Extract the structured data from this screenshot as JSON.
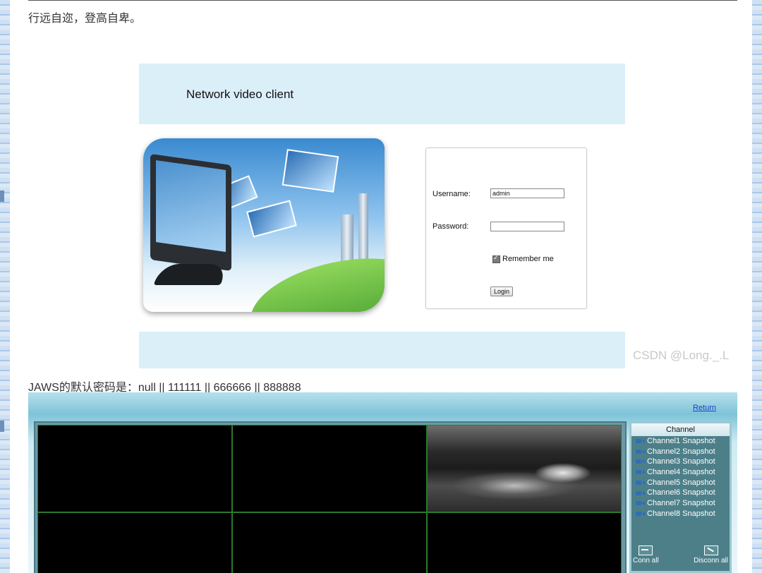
{
  "page": {
    "motto": "行远自迩，登高自卑。",
    "watermark": "CSDN @Long._.L",
    "jaws_note": "JAWS的默认密码是：null || 111111 || 666666 || 888888"
  },
  "login_screen": {
    "banner_title": "Network video client",
    "username_label": "Username:",
    "username_value": "admin",
    "password_label": "Password:",
    "password_value": "",
    "remember_label": "Remember me",
    "remember_checked": true,
    "login_button": "Login"
  },
  "viewer": {
    "return_link": "Return",
    "channel_title": "Channel",
    "channels": [
      "Channel1 Snapshot",
      "Channel2 Snapshot",
      "Channel3 Snapshot",
      "Channel4 Snapshot",
      "Channel5 Snapshot",
      "Channel6 Snapshot",
      "Channel7 Snapshot",
      "Channel8 Snapshot"
    ],
    "conn_all": "Conn all",
    "disconn_all": "Disconn all",
    "colors": {
      "panel": "#4d7f89",
      "grid_line": "#2b7a2b",
      "link": "#1a3ec9"
    }
  }
}
